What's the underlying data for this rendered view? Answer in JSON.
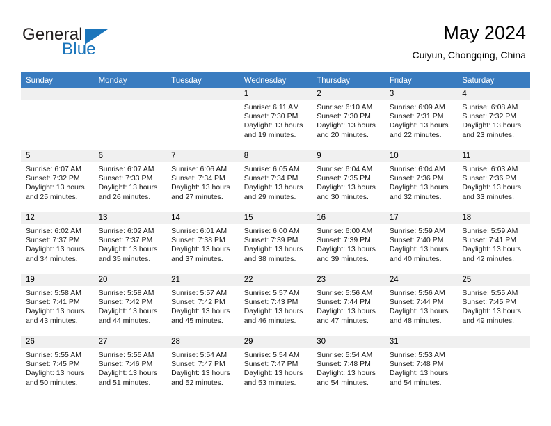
{
  "logo": {
    "word_one": "General",
    "word_two": "Blue",
    "accent_color": "#1b75bb",
    "text_color": "#231f20"
  },
  "header": {
    "title": "May 2024",
    "subtitle": "Cuiyun, Chongqing, China",
    "header_bg": "#3a7cc0",
    "band_bg": "#f0f0f0"
  },
  "weekdays": [
    "Sunday",
    "Monday",
    "Tuesday",
    "Wednesday",
    "Thursday",
    "Friday",
    "Saturday"
  ],
  "weeks": [
    [
      {
        "day": "",
        "empty": true
      },
      {
        "day": "",
        "empty": true
      },
      {
        "day": "",
        "empty": true
      },
      {
        "day": "1",
        "sunrise": "Sunrise: 6:11 AM",
        "sunset": "Sunset: 7:30 PM",
        "daylight_1": "Daylight: 13 hours",
        "daylight_2": "and 19 minutes."
      },
      {
        "day": "2",
        "sunrise": "Sunrise: 6:10 AM",
        "sunset": "Sunset: 7:30 PM",
        "daylight_1": "Daylight: 13 hours",
        "daylight_2": "and 20 minutes."
      },
      {
        "day": "3",
        "sunrise": "Sunrise: 6:09 AM",
        "sunset": "Sunset: 7:31 PM",
        "daylight_1": "Daylight: 13 hours",
        "daylight_2": "and 22 minutes."
      },
      {
        "day": "4",
        "sunrise": "Sunrise: 6:08 AM",
        "sunset": "Sunset: 7:32 PM",
        "daylight_1": "Daylight: 13 hours",
        "daylight_2": "and 23 minutes."
      }
    ],
    [
      {
        "day": "5",
        "sunrise": "Sunrise: 6:07 AM",
        "sunset": "Sunset: 7:32 PM",
        "daylight_1": "Daylight: 13 hours",
        "daylight_2": "and 25 minutes."
      },
      {
        "day": "6",
        "sunrise": "Sunrise: 6:07 AM",
        "sunset": "Sunset: 7:33 PM",
        "daylight_1": "Daylight: 13 hours",
        "daylight_2": "and 26 minutes."
      },
      {
        "day": "7",
        "sunrise": "Sunrise: 6:06 AM",
        "sunset": "Sunset: 7:34 PM",
        "daylight_1": "Daylight: 13 hours",
        "daylight_2": "and 27 minutes."
      },
      {
        "day": "8",
        "sunrise": "Sunrise: 6:05 AM",
        "sunset": "Sunset: 7:34 PM",
        "daylight_1": "Daylight: 13 hours",
        "daylight_2": "and 29 minutes."
      },
      {
        "day": "9",
        "sunrise": "Sunrise: 6:04 AM",
        "sunset": "Sunset: 7:35 PM",
        "daylight_1": "Daylight: 13 hours",
        "daylight_2": "and 30 minutes."
      },
      {
        "day": "10",
        "sunrise": "Sunrise: 6:04 AM",
        "sunset": "Sunset: 7:36 PM",
        "daylight_1": "Daylight: 13 hours",
        "daylight_2": "and 32 minutes."
      },
      {
        "day": "11",
        "sunrise": "Sunrise: 6:03 AM",
        "sunset": "Sunset: 7:36 PM",
        "daylight_1": "Daylight: 13 hours",
        "daylight_2": "and 33 minutes."
      }
    ],
    [
      {
        "day": "12",
        "sunrise": "Sunrise: 6:02 AM",
        "sunset": "Sunset: 7:37 PM",
        "daylight_1": "Daylight: 13 hours",
        "daylight_2": "and 34 minutes."
      },
      {
        "day": "13",
        "sunrise": "Sunrise: 6:02 AM",
        "sunset": "Sunset: 7:37 PM",
        "daylight_1": "Daylight: 13 hours",
        "daylight_2": "and 35 minutes."
      },
      {
        "day": "14",
        "sunrise": "Sunrise: 6:01 AM",
        "sunset": "Sunset: 7:38 PM",
        "daylight_1": "Daylight: 13 hours",
        "daylight_2": "and 37 minutes."
      },
      {
        "day": "15",
        "sunrise": "Sunrise: 6:00 AM",
        "sunset": "Sunset: 7:39 PM",
        "daylight_1": "Daylight: 13 hours",
        "daylight_2": "and 38 minutes."
      },
      {
        "day": "16",
        "sunrise": "Sunrise: 6:00 AM",
        "sunset": "Sunset: 7:39 PM",
        "daylight_1": "Daylight: 13 hours",
        "daylight_2": "and 39 minutes."
      },
      {
        "day": "17",
        "sunrise": "Sunrise: 5:59 AM",
        "sunset": "Sunset: 7:40 PM",
        "daylight_1": "Daylight: 13 hours",
        "daylight_2": "and 40 minutes."
      },
      {
        "day": "18",
        "sunrise": "Sunrise: 5:59 AM",
        "sunset": "Sunset: 7:41 PM",
        "daylight_1": "Daylight: 13 hours",
        "daylight_2": "and 42 minutes."
      }
    ],
    [
      {
        "day": "19",
        "sunrise": "Sunrise: 5:58 AM",
        "sunset": "Sunset: 7:41 PM",
        "daylight_1": "Daylight: 13 hours",
        "daylight_2": "and 43 minutes."
      },
      {
        "day": "20",
        "sunrise": "Sunrise: 5:58 AM",
        "sunset": "Sunset: 7:42 PM",
        "daylight_1": "Daylight: 13 hours",
        "daylight_2": "and 44 minutes."
      },
      {
        "day": "21",
        "sunrise": "Sunrise: 5:57 AM",
        "sunset": "Sunset: 7:42 PM",
        "daylight_1": "Daylight: 13 hours",
        "daylight_2": "and 45 minutes."
      },
      {
        "day": "22",
        "sunrise": "Sunrise: 5:57 AM",
        "sunset": "Sunset: 7:43 PM",
        "daylight_1": "Daylight: 13 hours",
        "daylight_2": "and 46 minutes."
      },
      {
        "day": "23",
        "sunrise": "Sunrise: 5:56 AM",
        "sunset": "Sunset: 7:44 PM",
        "daylight_1": "Daylight: 13 hours",
        "daylight_2": "and 47 minutes."
      },
      {
        "day": "24",
        "sunrise": "Sunrise: 5:56 AM",
        "sunset": "Sunset: 7:44 PM",
        "daylight_1": "Daylight: 13 hours",
        "daylight_2": "and 48 minutes."
      },
      {
        "day": "25",
        "sunrise": "Sunrise: 5:55 AM",
        "sunset": "Sunset: 7:45 PM",
        "daylight_1": "Daylight: 13 hours",
        "daylight_2": "and 49 minutes."
      }
    ],
    [
      {
        "day": "26",
        "sunrise": "Sunrise: 5:55 AM",
        "sunset": "Sunset: 7:45 PM",
        "daylight_1": "Daylight: 13 hours",
        "daylight_2": "and 50 minutes."
      },
      {
        "day": "27",
        "sunrise": "Sunrise: 5:55 AM",
        "sunset": "Sunset: 7:46 PM",
        "daylight_1": "Daylight: 13 hours",
        "daylight_2": "and 51 minutes."
      },
      {
        "day": "28",
        "sunrise": "Sunrise: 5:54 AM",
        "sunset": "Sunset: 7:47 PM",
        "daylight_1": "Daylight: 13 hours",
        "daylight_2": "and 52 minutes."
      },
      {
        "day": "29",
        "sunrise": "Sunrise: 5:54 AM",
        "sunset": "Sunset: 7:47 PM",
        "daylight_1": "Daylight: 13 hours",
        "daylight_2": "and 53 minutes."
      },
      {
        "day": "30",
        "sunrise": "Sunrise: 5:54 AM",
        "sunset": "Sunset: 7:48 PM",
        "daylight_1": "Daylight: 13 hours",
        "daylight_2": "and 54 minutes."
      },
      {
        "day": "31",
        "sunrise": "Sunrise: 5:53 AM",
        "sunset": "Sunset: 7:48 PM",
        "daylight_1": "Daylight: 13 hours",
        "daylight_2": "and 54 minutes."
      },
      {
        "day": "",
        "empty": true
      }
    ]
  ]
}
